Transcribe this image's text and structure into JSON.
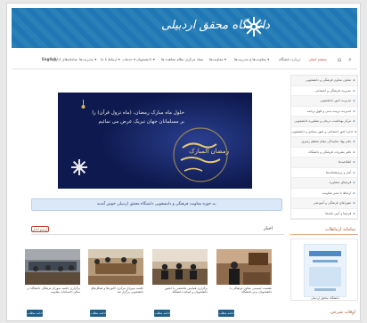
{
  "header": {
    "logo_text": "دانشگاه محقق اردبیلی",
    "logo_icon": "university-emblem-icon"
  },
  "nav": {
    "items": [
      {
        "label": "صفحه اصلی",
        "active": true
      },
      {
        "label": "درباره دانشگاه"
      },
      {
        "label": "معاونت‌ها و مدیریت‌ها ▾"
      },
      {
        "label": "معاونت‌ها ▾"
      },
      {
        "label": "ستاد مرکزی نظام معاهده ها"
      },
      {
        "label": "دانشجویان ▾"
      },
      {
        "label": "خدمات ▾"
      },
      {
        "label": "ارتباط با ما ▾"
      },
      {
        "label": "مدیریت‌ها ▾"
      },
      {
        "label": "سامانه‌های اداری"
      },
      {
        "label": "English"
      }
    ],
    "search_icon": "search-icon",
    "home_icon": "home-icon"
  },
  "sidebar": {
    "items": [
      "معاون معاون فرهنگی و دانشجویی",
      "مدیریت فرهنگی و اجتماعی",
      "مدیریت امور دانشجویی",
      "مدیریت تربیت بدنی و فوق برنامه",
      "مرکز بهداشت، درمان و مشاوره دانشجویی",
      "اداره امور اجتماعی و امور ستادی و دانشجویی",
      "دفتر نهاد نمایندگی مقام معظم رهبری",
      "دفتر نشریات فرهنگی و دانشگاه",
      "اطلاعیه‌ها",
      "آمار و پرسشنامه‌ها",
      "فرم‌های مشاوره",
      "ارتباط با مدیر معاونت",
      "شوراهای فرهنگی و آموزشی",
      "فرم‌ها و آیین نامه‌ها"
    ],
    "blog_heading": "سامانه ارتباطات",
    "blog_caption": "دانشگاه محقق اردبیلی",
    "hours_heading": "اوقات شرعی"
  },
  "banner": {
    "line1": "حلول ماه مبارک رمضان، (ماه نزول قرآن) را",
    "line2": "بر مسلمانان جهان تبریک عرض می نمائیم",
    "calligraphy": "رمضان المبارک"
  },
  "notice": {
    "text": "به حوزه معاونت فرهنگی و دانشجویی دانشگاه محقق اردبیلی خوش آمدید."
  },
  "news": {
    "title": "اخبار",
    "archive_label": "آرشیو اخبار",
    "items": [
      {
        "caption": "برگزاری جلسه شورای فرهنگی دانشگاه در سالن اجتماعات معاونت",
        "more": "ادامه مطلب"
      },
      {
        "caption": "جلسه شورای مرکزی کانون‌ها و تشکل‌های دانشجویی برگزار شد",
        "more": "ادامه مطلب"
      },
      {
        "caption": "برگزاری همایش تخصصی با حضور دانشجویان و اساتید دانشگاه",
        "more": "ادامه مطلب"
      },
      {
        "caption": "نشست صمیمی معاون فرهنگی با دانشجویان برتر دانشگاه",
        "more": "ادامه مطلب"
      }
    ]
  },
  "colors": {
    "header_blue": "#1f78b4",
    "banner_navy": "#0e1a4f",
    "accent_red": "#c0392b",
    "notice_bg": "#dbe8f7"
  }
}
